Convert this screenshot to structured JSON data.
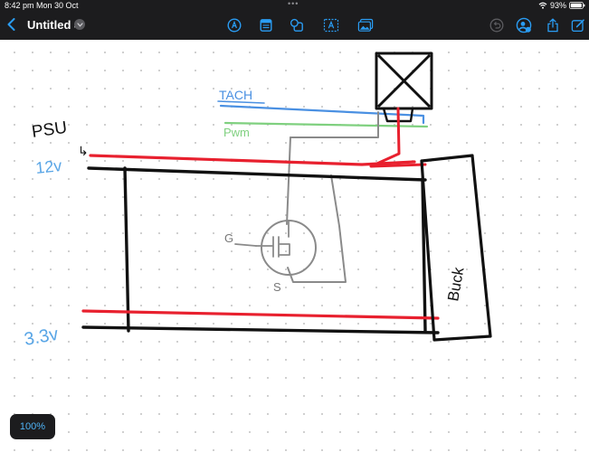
{
  "status": {
    "time": "8:42 pm",
    "date": "Mon 30 Oct",
    "battery": "93%",
    "wifi_icon": "wifi-icon",
    "battery_icon": "battery-icon"
  },
  "toolbar": {
    "title": "Untitled 4",
    "back_icon": "chevron-left-icon",
    "title_menu_icon": "chevron-down-icon",
    "tools": [
      "pen-tool-icon",
      "notebook-icon",
      "shapes-icon",
      "text-box-icon",
      "image-icon"
    ],
    "right_tools": [
      "undo-icon",
      "collaborator-icon",
      "share-icon",
      "compose-icon"
    ],
    "accent": "#2a9df4"
  },
  "sketch": {
    "labels": {
      "psu": "PSU",
      "psu_arrow": "↳",
      "v12": "12v",
      "v33": "3.3v",
      "tach": "TACH",
      "pwm": "Pwm",
      "gate": "G",
      "source": "S",
      "buck": "Buck"
    },
    "colors": {
      "red_wire": "#e8202e",
      "black_wire": "#111111",
      "tach_line": "#4a90e2",
      "pwm_line": "#7fd07f",
      "grey_wire": "#8a8a8a",
      "voltage_label": "#5aa6e6"
    }
  },
  "zoom": {
    "label": "100%"
  }
}
